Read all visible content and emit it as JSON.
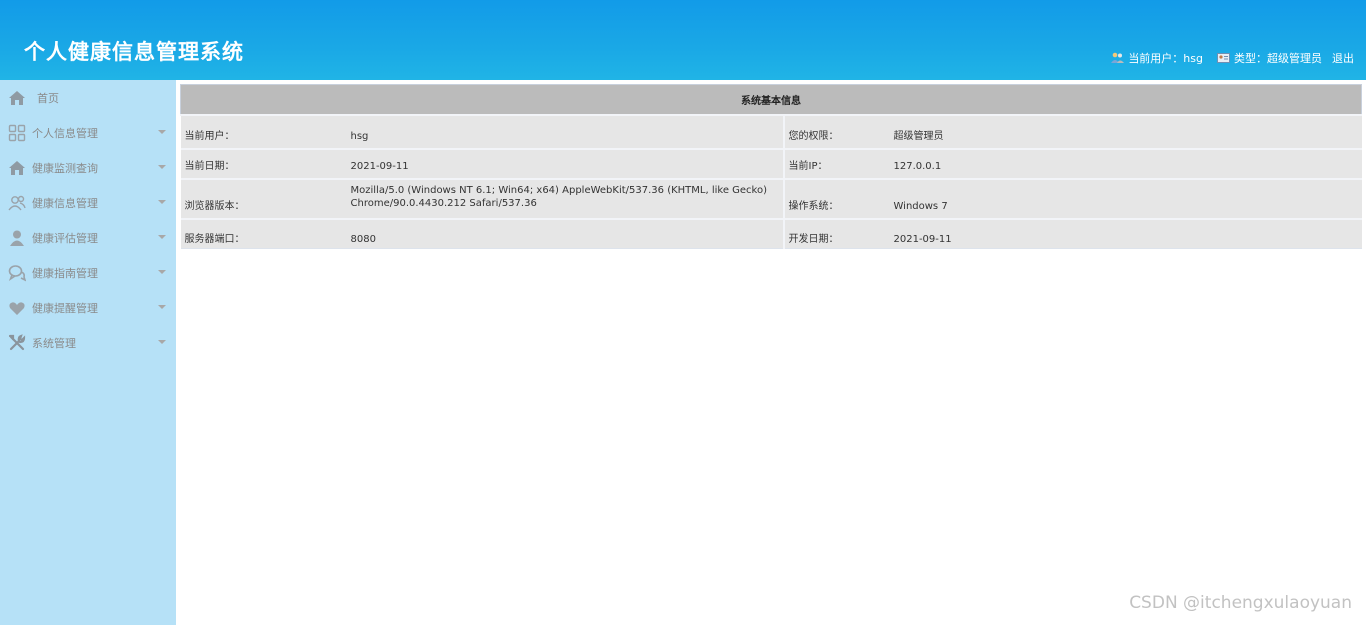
{
  "app": {
    "title": "个人健康信息管理系统"
  },
  "header": {
    "current_user_label": "当前用户：hsg",
    "user_type_label": "类型：超级管理员",
    "logout": "退出",
    "user_icon": "users-icon",
    "type_icon": "id-card-icon"
  },
  "sidebar": {
    "items": [
      {
        "label": "首页",
        "icon": "home-icon"
      },
      {
        "label": "个人信息管理",
        "icon": "grid-icon"
      },
      {
        "label": "健康监测查询",
        "icon": "home-icon"
      },
      {
        "label": "健康信息管理",
        "icon": "users-icon"
      },
      {
        "label": "健康评估管理",
        "icon": "user-icon"
      },
      {
        "label": "健康指南管理",
        "icon": "chat-icon"
      },
      {
        "label": "健康提醒管理",
        "icon": "heart-icon"
      },
      {
        "label": "系统管理",
        "icon": "tools-icon"
      }
    ]
  },
  "info": {
    "title": "系统基本信息",
    "rows": [
      {
        "label1": "当前用户：",
        "value1": "hsg",
        "label2": "您的权限：",
        "value2": "超级管理员"
      },
      {
        "label1": "当前日期：",
        "value1": "2021-09-11",
        "label2": "当前IP：",
        "value2": "127.0.0.1"
      },
      {
        "label1": "浏览器版本：",
        "value1": "Mozilla/5.0 (Windows NT 6.1; Win64; x64) AppleWebKit/537.36 (KHTML, like Gecko) Chrome/90.0.4430.212 Safari/537.36",
        "label2": "操作系统：",
        "value2": "Windows 7"
      },
      {
        "label1": "服务器端口：",
        "value1": "8080",
        "label2": "开发日期：",
        "value2": "2021-09-11"
      }
    ]
  },
  "watermark": "CSDN @itchengxulaoyuan",
  "colors": {
    "header": "#129be8",
    "sidebar": "#b6e1f7",
    "table_header": "#bbbbbb",
    "table_cell": "#e6e6e6"
  }
}
